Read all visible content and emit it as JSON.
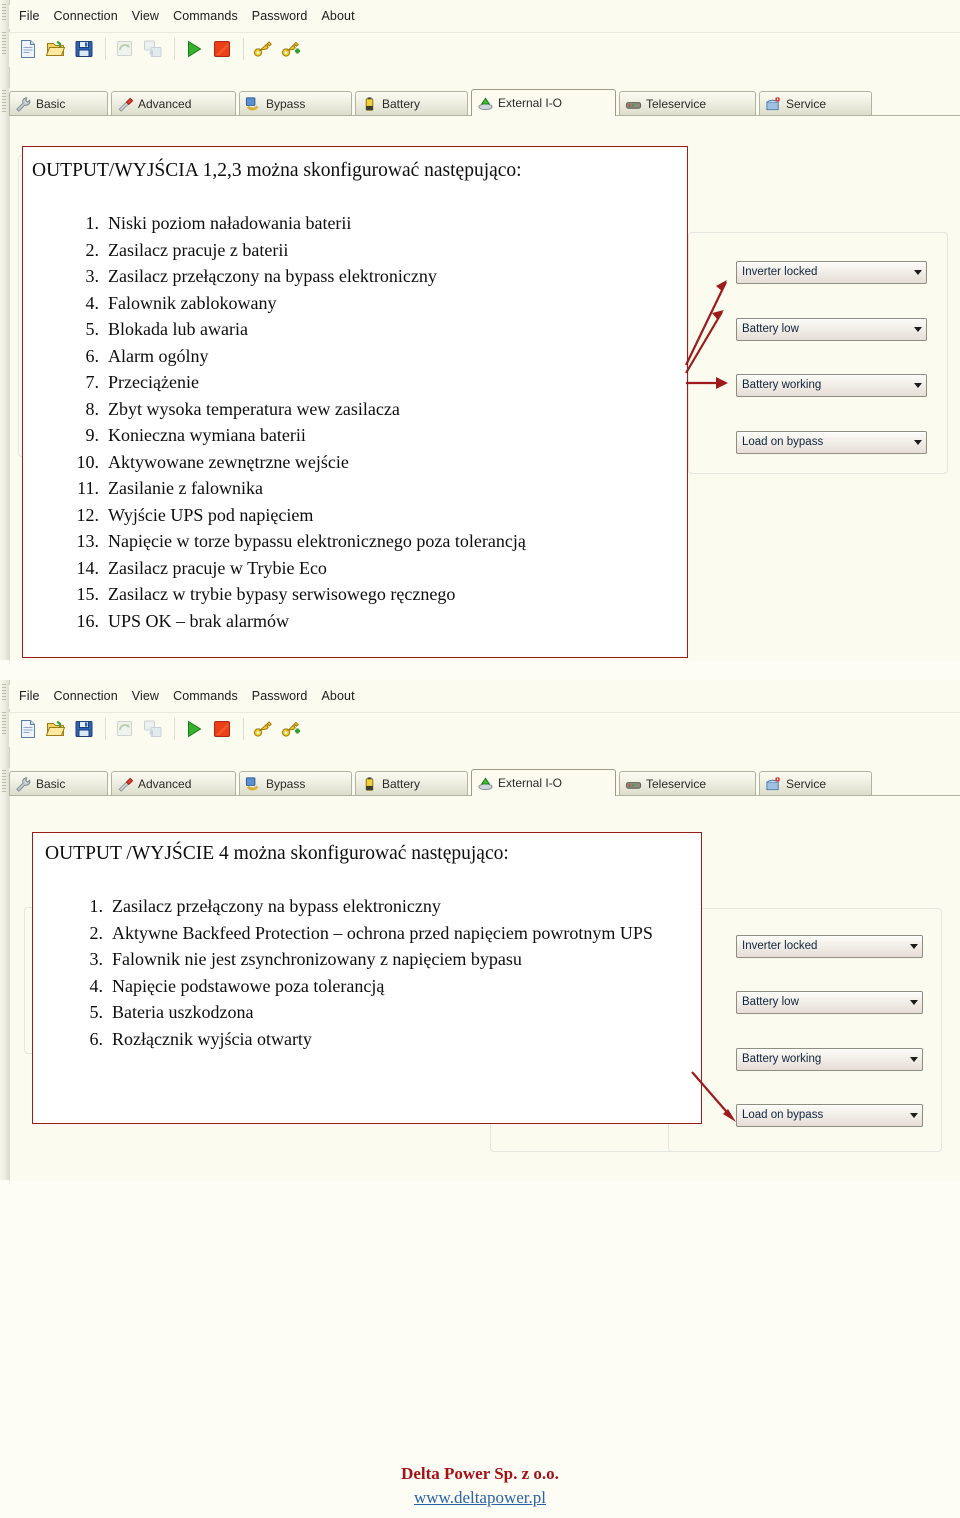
{
  "window": {
    "menubar": [
      "File",
      "Connection",
      "View",
      "Commands",
      "Password",
      "About"
    ],
    "toolbar_icons": [
      "new-document-icon",
      "open-folder-icon",
      "save-disk-icon",
      "refresh-disabled-icon",
      "transfer-disabled-icon",
      "play-icon",
      "stop-icon",
      "key-icon",
      "key-add-icon"
    ],
    "tabs": [
      {
        "label": "Basic",
        "icon": "wrench-icon",
        "active": false
      },
      {
        "label": "Advanced",
        "icon": "screwdriver-icon",
        "active": false
      },
      {
        "label": "Bypass",
        "icon": "bypass-icon",
        "active": false
      },
      {
        "label": "Battery",
        "icon": "battery-icon",
        "active": false
      },
      {
        "label": "External I-O",
        "icon": "external-io-icon",
        "active": true
      },
      {
        "label": "Teleservice",
        "icon": "modem-icon",
        "active": false
      },
      {
        "label": "Service",
        "icon": "service-icon",
        "active": false
      }
    ]
  },
  "section1": {
    "heading": "OUTPUT/WYJŚCIA 1,2,3 można skonfigurować następująco:",
    "items": [
      "Niski poziom naładowania baterii",
      "Zasilacz pracuje z baterii",
      "Zasilacz przełączony na bypass elektroniczny",
      "Falownik zablokowany",
      "Blokada lub awaria",
      "Alarm ogólny",
      "Przeciążenie",
      "Zbyt wysoka temperatura wew zasilacza",
      "Konieczna wymiana baterii",
      "Aktywowane zewnętrzne wejście",
      "Zasilanie z falownika",
      "Wyjście UPS pod napięciem",
      "Napięcie w torze bypassu elektronicznego poza tolerancją",
      "Zasilacz pracuje w Trybie Eco",
      "Zasilacz w trybie bypasy serwisowego ręcznego",
      "UPS OK – brak alarmów"
    ],
    "numbers": [
      "1.",
      "2.",
      "3.",
      "4.",
      "5.",
      "6.",
      "7.",
      "8.",
      "9.",
      "10.",
      "11.",
      "12.",
      "13.",
      "14.",
      "15.",
      "16."
    ],
    "combos": [
      "Inverter locked",
      "Battery low",
      "Battery working",
      "Load on bypass"
    ]
  },
  "section2": {
    "heading": "OUTPUT /WYJŚCIE 4 można skonfigurować następująco:",
    "items": [
      "Zasilacz przełączony na bypass elektroniczny",
      "Aktywne Backfeed Protection – ochrona przed napięciem powrotnym UPS",
      "Falownik nie jest zsynchronizowany z napięciem bypasu",
      "Napięcie podstawowe poza tolerancją",
      "Bateria uszkodzona",
      "Rozłącznik wyjścia otwarty"
    ],
    "numbers": [
      "1.",
      "2.",
      "3.",
      "4.",
      "5.",
      "6."
    ],
    "combos": [
      "Inverter locked",
      "Battery low",
      "Battery working",
      "Load on bypass"
    ]
  },
  "footer": {
    "company": "Delta Power Sp. z o.o.",
    "url": "www.deltapower.pl"
  },
  "colors": {
    "annotation_red": "#9e1b1b",
    "footer_red": "#a41116",
    "link_blue": "#2a62a8",
    "page_bg": "#fdfdf6",
    "window_bg": "#fbfbf0"
  }
}
